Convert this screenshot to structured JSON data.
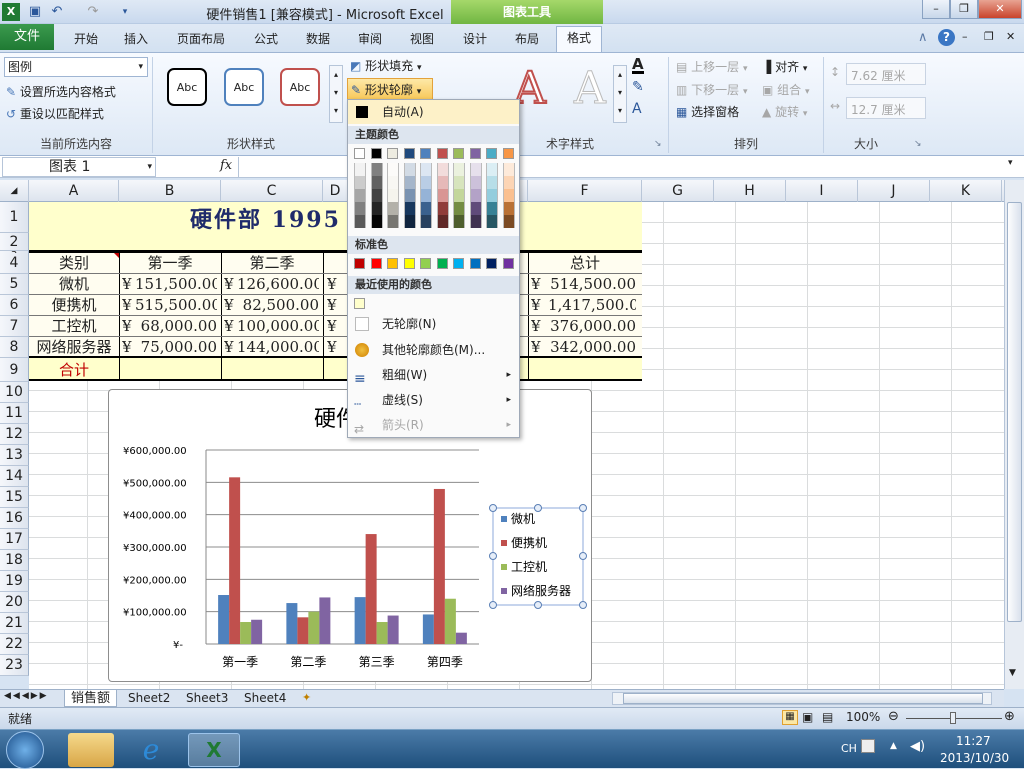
{
  "window": {
    "title": "硬件销售1 [兼容模式] - Microsoft Excel",
    "context_tab": "图表工具"
  },
  "tabs": {
    "file": "文件",
    "items": [
      "开始",
      "插入",
      "页面布局",
      "公式",
      "数据",
      "审阅",
      "视图",
      "设计",
      "布局",
      "格式"
    ],
    "active": "格式"
  },
  "ribbon": {
    "current_selection": {
      "dropdown": "图例",
      "format_btn": "设置所选内容格式",
      "reset_btn": "重设以匹配样式",
      "label": "当前所选内容"
    },
    "shape_styles": {
      "sample": "Abc",
      "label": "形状样式",
      "fill": "形状填充",
      "outline": "形状轮廓"
    },
    "wordart": {
      "label": "艺术字样式",
      "label_visible": "术字样式"
    },
    "arrange": {
      "bring_forward": "上移一层",
      "send_backward": "下移一层",
      "selection_pane": "选择窗格",
      "align": "对齐",
      "group": "组合",
      "rotate": "旋转",
      "label": "排列"
    },
    "size": {
      "height": "7.62 厘米",
      "width": "12.7 厘米",
      "label": "大小"
    }
  },
  "formula_bar": {
    "name_box": "图表 1",
    "fx": "fx"
  },
  "columns": [
    "A",
    "B",
    "C",
    "D",
    "E",
    "F",
    "G",
    "H",
    "I",
    "J",
    "K"
  ],
  "rows": [
    "1",
    "2",
    "3",
    "4",
    "5",
    "6",
    "7",
    "8",
    "9",
    "10",
    "11",
    "12",
    "13",
    "14",
    "15",
    "16",
    "17",
    "18",
    "19",
    "20",
    "21",
    "22",
    "23"
  ],
  "sheet": {
    "title": "硬件部 1995",
    "headers": [
      "类别",
      "第一季",
      "第二季",
      "",
      "",
      "总计"
    ],
    "rows": [
      {
        "cat": "微机",
        "q1": "151,500.00",
        "q2": "126,600.00",
        "total": "514,500.00"
      },
      {
        "cat": "便携机",
        "q1": "515,500.00",
        "q2": "82,500.00",
        "total": "1,417,500.00"
      },
      {
        "cat": "工控机",
        "q1": "68,000.00",
        "q2": "100,000.00",
        "total": "376,000.00"
      },
      {
        "cat": "网络服务器",
        "q1": "75,000.00",
        "q2": "144,000.00",
        "total": "342,000.00"
      }
    ],
    "yen": "¥",
    "sum_label": "合计"
  },
  "outline_menu": {
    "auto": "自动(A)",
    "theme_colors": "主题颜色",
    "standard_colors": "标准色",
    "recent_colors": "最近使用的颜色",
    "no_outline": "无轮廓(N)",
    "more_colors": "其他轮廓颜色(M)...",
    "weight": "粗细(W)",
    "dashes": "虚线(S)",
    "arrows": "箭头(R)",
    "theme_top": [
      "#ffffff",
      "#000000",
      "#eeece1",
      "#1f497d",
      "#4f81bd",
      "#c0504d",
      "#9bbb59",
      "#8064a2",
      "#4bacc6",
      "#f79646"
    ],
    "standard": [
      "#c00000",
      "#ff0000",
      "#ffc000",
      "#ffff00",
      "#92d050",
      "#00b050",
      "#00b0f0",
      "#0070c0",
      "#002060",
      "#7030a0"
    ],
    "recent": [
      "#ffffcc"
    ]
  },
  "chart_data": {
    "type": "bar",
    "title": "硬件部",
    "categories": [
      "第一季",
      "第二季",
      "第三季",
      "第四季"
    ],
    "series": [
      {
        "name": "微机",
        "color": "#4f81bd",
        "values": [
          151500,
          126600,
          145000,
          91400
        ]
      },
      {
        "name": "便携机",
        "color": "#c0504d",
        "values": [
          515500,
          82500,
          340000,
          479500
        ]
      },
      {
        "name": "工控机",
        "color": "#9bbb59",
        "values": [
          68000,
          100000,
          68000,
          140000
        ]
      },
      {
        "name": "网络服务器",
        "color": "#8064a2",
        "values": [
          75000,
          144000,
          88000,
          35000
        ]
      }
    ],
    "y_ticks": [
      "¥-",
      "¥100,000.00",
      "¥200,000.00",
      "¥300,000.00",
      "¥400,000.00",
      "¥500,000.00",
      "¥600,000.00"
    ],
    "ylim": [
      0,
      600000
    ],
    "legend": "right"
  },
  "sheet_tabs": [
    "销售额",
    "Sheet2",
    "Sheet3",
    "Sheet4"
  ],
  "status": {
    "ready": "就绪",
    "zoom": "100%"
  },
  "taskbar": {
    "lang": "CH",
    "time": "11:27",
    "date": "2013/10/30"
  }
}
